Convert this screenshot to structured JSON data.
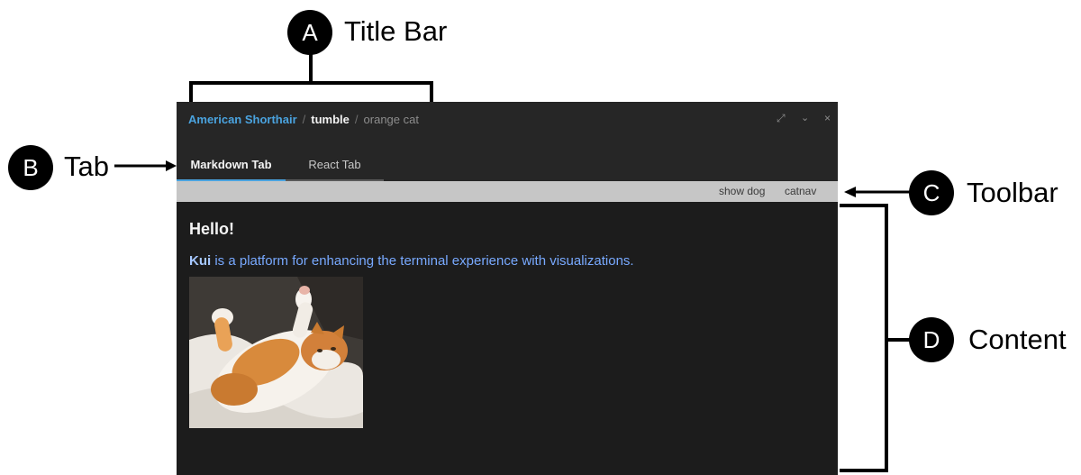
{
  "annotations": [
    {
      "letter": "A",
      "label": "Title Bar"
    },
    {
      "letter": "B",
      "label": "Tab"
    },
    {
      "letter": "C",
      "label": "Toolbar"
    },
    {
      "letter": "D",
      "label": "Content"
    }
  ],
  "window": {
    "breadcrumbs": [
      "American Shorthair",
      "tumble",
      "orange cat"
    ],
    "separator": "/",
    "controls": {
      "maximize": "⤢",
      "minimize": "⌄",
      "close": "×"
    }
  },
  "tabs": [
    {
      "label": "Markdown Tab",
      "active": true
    },
    {
      "label": "React Tab",
      "active": false
    }
  ],
  "toolbar": {
    "buttons": [
      "show dog",
      "catnav"
    ]
  },
  "content": {
    "heading": "Hello!",
    "paragraph": {
      "link": "Kui",
      "text": " is a platform for enhancing the terminal experience with visualizations."
    },
    "image": {
      "subject": "orange-and-white cat lying on its back"
    }
  },
  "colors": {
    "accent": "#4aa3df",
    "window_bg": "#1c1c1c",
    "titlebar_bg": "#262626",
    "toolbar_bg": "#c6c6c6",
    "link": "#78a9ff"
  }
}
